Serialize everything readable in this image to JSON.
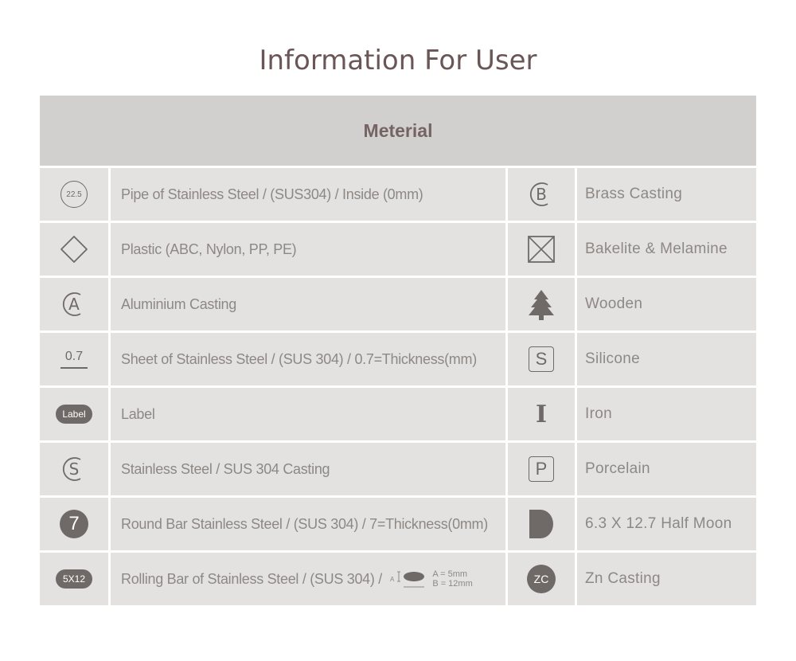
{
  "page": {
    "title": "Information For User"
  },
  "table": {
    "header": "Meterial",
    "rows": [
      {
        "left_icon": "22.5",
        "left_text": "Pipe of Stainless Steel / (SUS304) / Inside (0mm)",
        "right_icon": "circle-b-icon",
        "right_text": "Brass Casting"
      },
      {
        "left_icon": "diamond-icon",
        "left_text": "Plastic (ABC, Nylon, PP, PE)",
        "right_icon": "boxed-x-icon",
        "right_text": "Bakelite & Melamine"
      },
      {
        "left_icon": "circle-a-icon",
        "left_text": "Aluminium Casting",
        "right_icon": "tree-icon",
        "right_text": "Wooden"
      },
      {
        "left_icon": "0.7",
        "left_text": "Sheet of Stainless Steel / (SUS 304) / 0.7=Thickness(mm)",
        "right_icon": "S",
        "right_text": "Silicone"
      },
      {
        "left_icon": "Label",
        "left_text": "Label",
        "right_icon": "I",
        "right_text": "Iron"
      },
      {
        "left_icon": "circle-s-icon",
        "left_text": "Stainless Steel / SUS 304 Casting",
        "right_icon": "P",
        "right_text": "Porcelain"
      },
      {
        "left_icon": "7",
        "left_text": "Round Bar Stainless Steel / (SUS 304) / 7=Thickness(0mm)",
        "right_icon": "half-moon-icon",
        "right_text": "6.3 X 12.7 Half Moon"
      },
      {
        "left_icon": "5X12",
        "left_text": "Rolling Bar of Stainless Steel / (SUS 304) /",
        "right_icon": "ZC",
        "right_text": "Zn Casting"
      }
    ],
    "rolling_diagram": {
      "a_mark": "A",
      "b_mark": "B",
      "spec_a": "A = 5mm",
      "spec_b": "B = 12mm"
    }
  },
  "colors": {
    "title": "#6a5656",
    "header_bg": "#d2d0cf",
    "cell_bg": "#e4e2e1",
    "icon": "#6f6a68",
    "text": "#8e8885"
  }
}
